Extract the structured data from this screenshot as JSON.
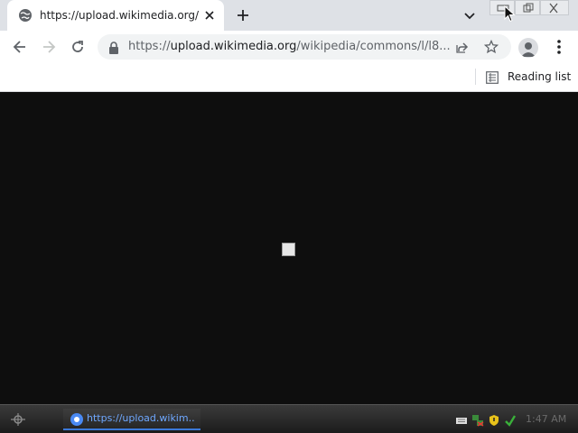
{
  "tab": {
    "title": "https://upload.wikimedia.org/wikipedia/commons/"
  },
  "address_bar": {
    "scheme": "https://",
    "domain": "upload.wikimedia.org",
    "path": "/wikipedia/commons/l/l8..."
  },
  "bookmarks_bar": {
    "reading_list_label": "Reading list"
  },
  "taskbar": {
    "task_label": "https://upload.wikim...",
    "clock": "1:47 AM"
  },
  "colors": {
    "accent": "#3b78d8",
    "page_background": "#0e0e0e"
  }
}
